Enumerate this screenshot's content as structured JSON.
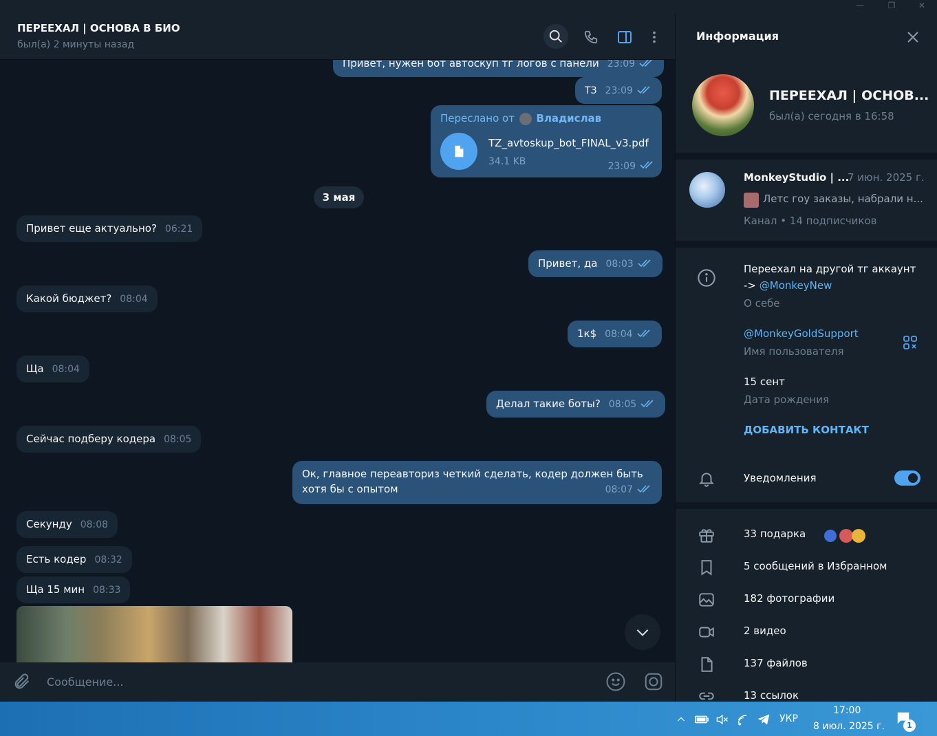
{
  "window": {
    "minimize": "—",
    "restore": "❐",
    "close": "✕"
  },
  "chat": {
    "title": "ПЕРЕЕХАЛ | ОСНОВА В БИО",
    "status": "был(а) 2 минуты назад"
  },
  "messages": {
    "top_partial": {
      "text": "Привет, нужен бот автоскуп тг логов с панели",
      "time": "23:09"
    },
    "tz": {
      "text": "ТЗ",
      "time": "23:09"
    },
    "forwarded": {
      "label": "Переслано от",
      "name": "Владислав",
      "file_name": "TZ_avtoskup_bot_FINAL_v3.pdf",
      "file_size": "34.1 KB",
      "time": "23:09"
    },
    "date_divider": "3 мая",
    "items": [
      {
        "text": "Привет еще актуально?",
        "time": "06:21"
      },
      {
        "text": "Привет, да",
        "time": "08:03"
      },
      {
        "text": "Какой бюджет?",
        "time": "08:04"
      },
      {
        "text": "1к$",
        "time": "08:04"
      },
      {
        "text": "Ща",
        "time": "08:04"
      },
      {
        "text": "Делал такие боты?",
        "time": "08:05"
      },
      {
        "text": "Сейчас подберу кодера",
        "time": "08:05"
      },
      {
        "text": "Ок, главное переавториз четкий сделать, кодер должен быть",
        "text2": "хотя бы с опытом",
        "time": "08:07"
      },
      {
        "text": "Секунду",
        "time": "08:08"
      },
      {
        "text": "Есть кодер",
        "time": "08:32"
      },
      {
        "text": "Ща 15 мин",
        "time": "08:33"
      }
    ]
  },
  "input": {
    "placeholder": "Сообщение..."
  },
  "panel": {
    "title": "Информация",
    "profile_name": "ПЕРЕЕХАЛ | ОСНОВ...",
    "profile_status": "был(а) сегодня в 16:58",
    "channel": {
      "name": "MonkeyStudio | ...",
      "date": "7 июн. 2025 г.",
      "preview": "Летс гоу заказы, набрали н...",
      "meta": "Канал • 14 подписчиков"
    },
    "bio": {
      "line1": "Переехал на другой тг аккаунт",
      "arrow": "->",
      "link": "@MonkeyNew",
      "label": "О себе"
    },
    "username": {
      "value": "@MonkeyGoldSupport",
      "label": "Имя пользователя"
    },
    "birthday": {
      "value": "15 сент",
      "label": "Дата рождения"
    },
    "add_contact": "ДОБАВИТЬ КОНТАКТ",
    "notifications": {
      "label": "Уведомления",
      "enabled": true
    },
    "media": [
      {
        "icon": "gift-icon",
        "label": "33 подарка"
      },
      {
        "icon": "bookmark-icon",
        "label": "5 сообщений в Избранном"
      },
      {
        "icon": "photo-icon",
        "label": "182 фотографии"
      },
      {
        "icon": "video-icon",
        "label": "2 видео"
      },
      {
        "icon": "file-icon",
        "label": "137 файлов"
      },
      {
        "icon": "link-icon",
        "label": "13 ссылок"
      }
    ]
  },
  "taskbar": {
    "language": "УКР",
    "time": "17:00",
    "date": "8 июл. 2025 г.",
    "notification_count": "1"
  },
  "colors": {
    "bg": "#0e1621",
    "header": "#17212b",
    "bubble_in": "#182533",
    "bubble_out": "#2b5278",
    "accent": "#5eb5f7",
    "taskbar": "#2b86c9"
  }
}
